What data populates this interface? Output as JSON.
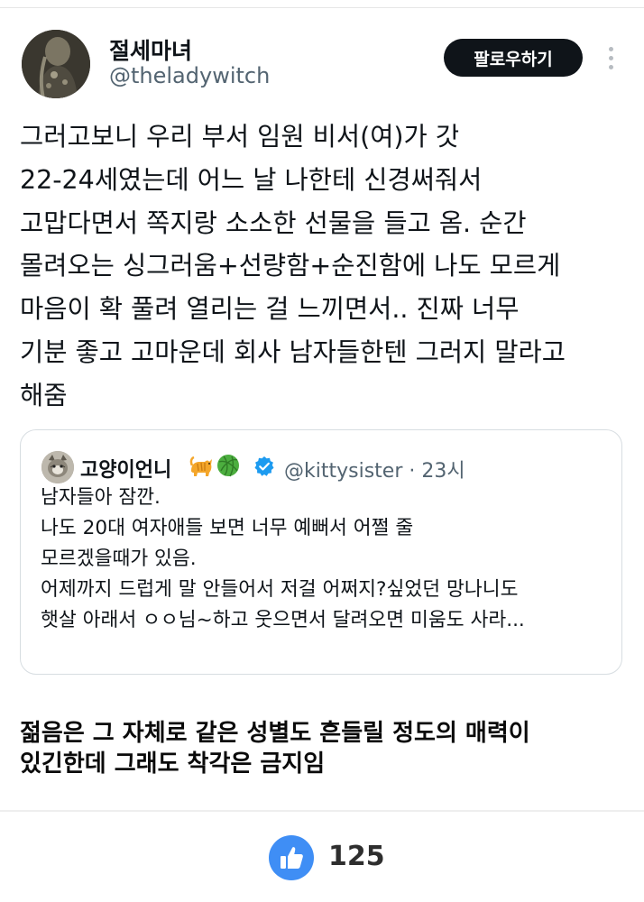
{
  "author": {
    "name": "절세마녀",
    "handle": "@theladywitch"
  },
  "follow_button": {
    "label": "팔로우하기"
  },
  "tweet": {
    "lines": [
      "그러고보니 우리 부서 임원 비서(여)가  갓",
      "22-24세였는데 어느 날 나한테 신경써줘서",
      "고맙다면서 쪽지랑 소소한 선물을 들고 옴. 순간",
      "몰려오는 싱그러움+선량함+순진함에 나도 모르게",
      "마음이 확 풀려 열리는 걸 느끼면서..  진짜 너무",
      "기분 좋고 고마운데 회사 남자들한텐 그러지 말라고",
      "해줌"
    ]
  },
  "quote": {
    "name": "고양이언니",
    "handle_time": "@kittysister · 23시",
    "emojis": [
      "cat-emoji",
      "yarn-ball-emoji"
    ],
    "lines": [
      "남자들아 잠깐.",
      "나도 20대 여자애들 보면 너무 예뻐서 어쩔 줄",
      "모르겠을때가 있음.",
      "어제까지 드럽게 말 안들어서 저걸 어쩌지?싶었던 망나니도",
      "햇살 아래서 ㅇㅇ님~하고 웃으면서 달려오면 미움도 사라..."
    ]
  },
  "comment": {
    "lines": [
      "젊음은 그 자체로 같은 성별도 흔들릴 정도의 매력이",
      "있긴한데 그래도 착각은 금지임"
    ]
  },
  "likes": {
    "count": "125"
  },
  "colors": {
    "text": "#0f1419",
    "secondary": "#536471",
    "follow_bg": "#0f1419",
    "verified": "#1d9bf0",
    "like_bg": "#3f8ef5"
  }
}
